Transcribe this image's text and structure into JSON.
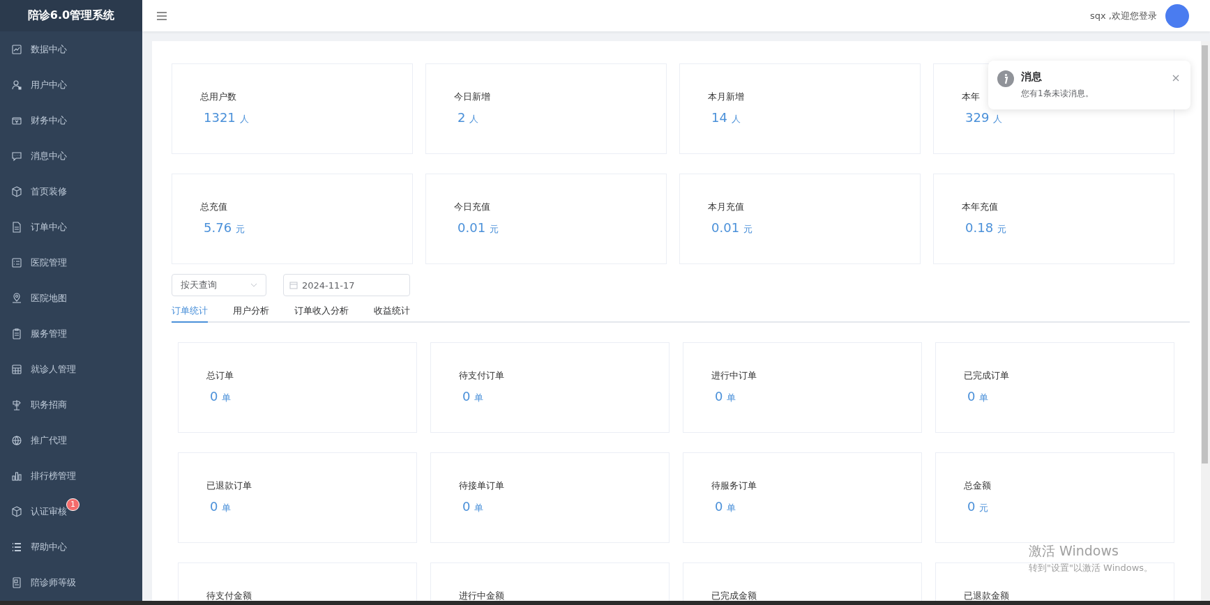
{
  "sidebar": {
    "title": "陪诊6.0管理系统",
    "items": [
      {
        "label": "数据中心"
      },
      {
        "label": "用户中心"
      },
      {
        "label": "财务中心"
      },
      {
        "label": "消息中心"
      },
      {
        "label": "首页装修"
      },
      {
        "label": "订单中心"
      },
      {
        "label": "医院管理"
      },
      {
        "label": "医院地图"
      },
      {
        "label": "服务管理"
      },
      {
        "label": "就诊人管理"
      },
      {
        "label": "职务招商"
      },
      {
        "label": "推广代理"
      },
      {
        "label": "排行榜管理"
      },
      {
        "label": "认证审核",
        "badge": "1"
      },
      {
        "label": "帮助中心"
      },
      {
        "label": "陪诊师等级"
      }
    ]
  },
  "header": {
    "greeting": "sqx ,欢迎您登录"
  },
  "user_stats": [
    {
      "label": "总用户数",
      "value": "1321",
      "unit": "人"
    },
    {
      "label": "今日新增",
      "value": "2",
      "unit": "人"
    },
    {
      "label": "本月新增",
      "value": "14",
      "unit": "人"
    },
    {
      "label": "本年",
      "value": "329",
      "unit": "人"
    }
  ],
  "recharge_stats": [
    {
      "label": "总充值",
      "value": "5.76",
      "unit": "元"
    },
    {
      "label": "今日充值",
      "value": "0.01",
      "unit": "元"
    },
    {
      "label": "本月充值",
      "value": "0.01",
      "unit": "元"
    },
    {
      "label": "本年充值",
      "value": "0.18",
      "unit": "元"
    }
  ],
  "filters": {
    "period_select": "按天查询",
    "date": "2024-11-17"
  },
  "tabs": [
    {
      "label": "订单统计",
      "selected": true
    },
    {
      "label": "用户分析",
      "selected": false
    },
    {
      "label": "订单收入分析",
      "selected": false
    },
    {
      "label": "收益统计",
      "selected": false
    }
  ],
  "order_stats": [
    {
      "label": "总订单",
      "value": "0",
      "unit": "单"
    },
    {
      "label": "待支付订单",
      "value": "0",
      "unit": "单"
    },
    {
      "label": "进行中订单",
      "value": "0",
      "unit": "单"
    },
    {
      "label": "已完成订单",
      "value": "0",
      "unit": "单"
    },
    {
      "label": "已退款订单",
      "value": "0",
      "unit": "单"
    },
    {
      "label": "待接单订单",
      "value": "0",
      "unit": "单"
    },
    {
      "label": "待服务订单",
      "value": "0",
      "unit": "单"
    },
    {
      "label": "总金额",
      "value": "0",
      "unit": "元"
    },
    {
      "label": "待支付金额"
    },
    {
      "label": "进行中金额"
    },
    {
      "label": "已完成金额"
    },
    {
      "label": "已退款金额"
    }
  ],
  "notification": {
    "title": "消息",
    "text": "您有1条未读消息。"
  },
  "os_notice": {
    "title": "激活 Windows",
    "text": "转到\"设置\"以激活 Windows。"
  }
}
